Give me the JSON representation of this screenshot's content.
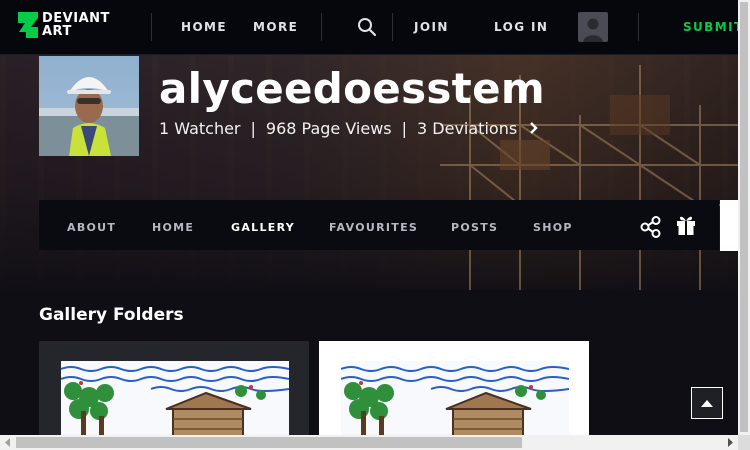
{
  "header": {
    "logo_text_line1": "DEVIANT",
    "logo_text_line2": "ART",
    "nav": [
      "HOME",
      "MORE"
    ],
    "join_label": "JOIN",
    "login_label": "LOG IN",
    "submit_label": "SUBMIT",
    "accent_color": "#05cc47"
  },
  "profile": {
    "username": "alyceedoesstem",
    "watchers": "1 Watcher",
    "page_views": "968 Page Views",
    "deviations": "3 Deviations",
    "separator": "|"
  },
  "tabs": [
    "ABOUT",
    "HOME",
    "GALLERY",
    "FAVOURITES",
    "POSTS",
    "SHOP"
  ],
  "active_tab": "GALLERY",
  "content": {
    "section_title": "Gallery Folders"
  }
}
